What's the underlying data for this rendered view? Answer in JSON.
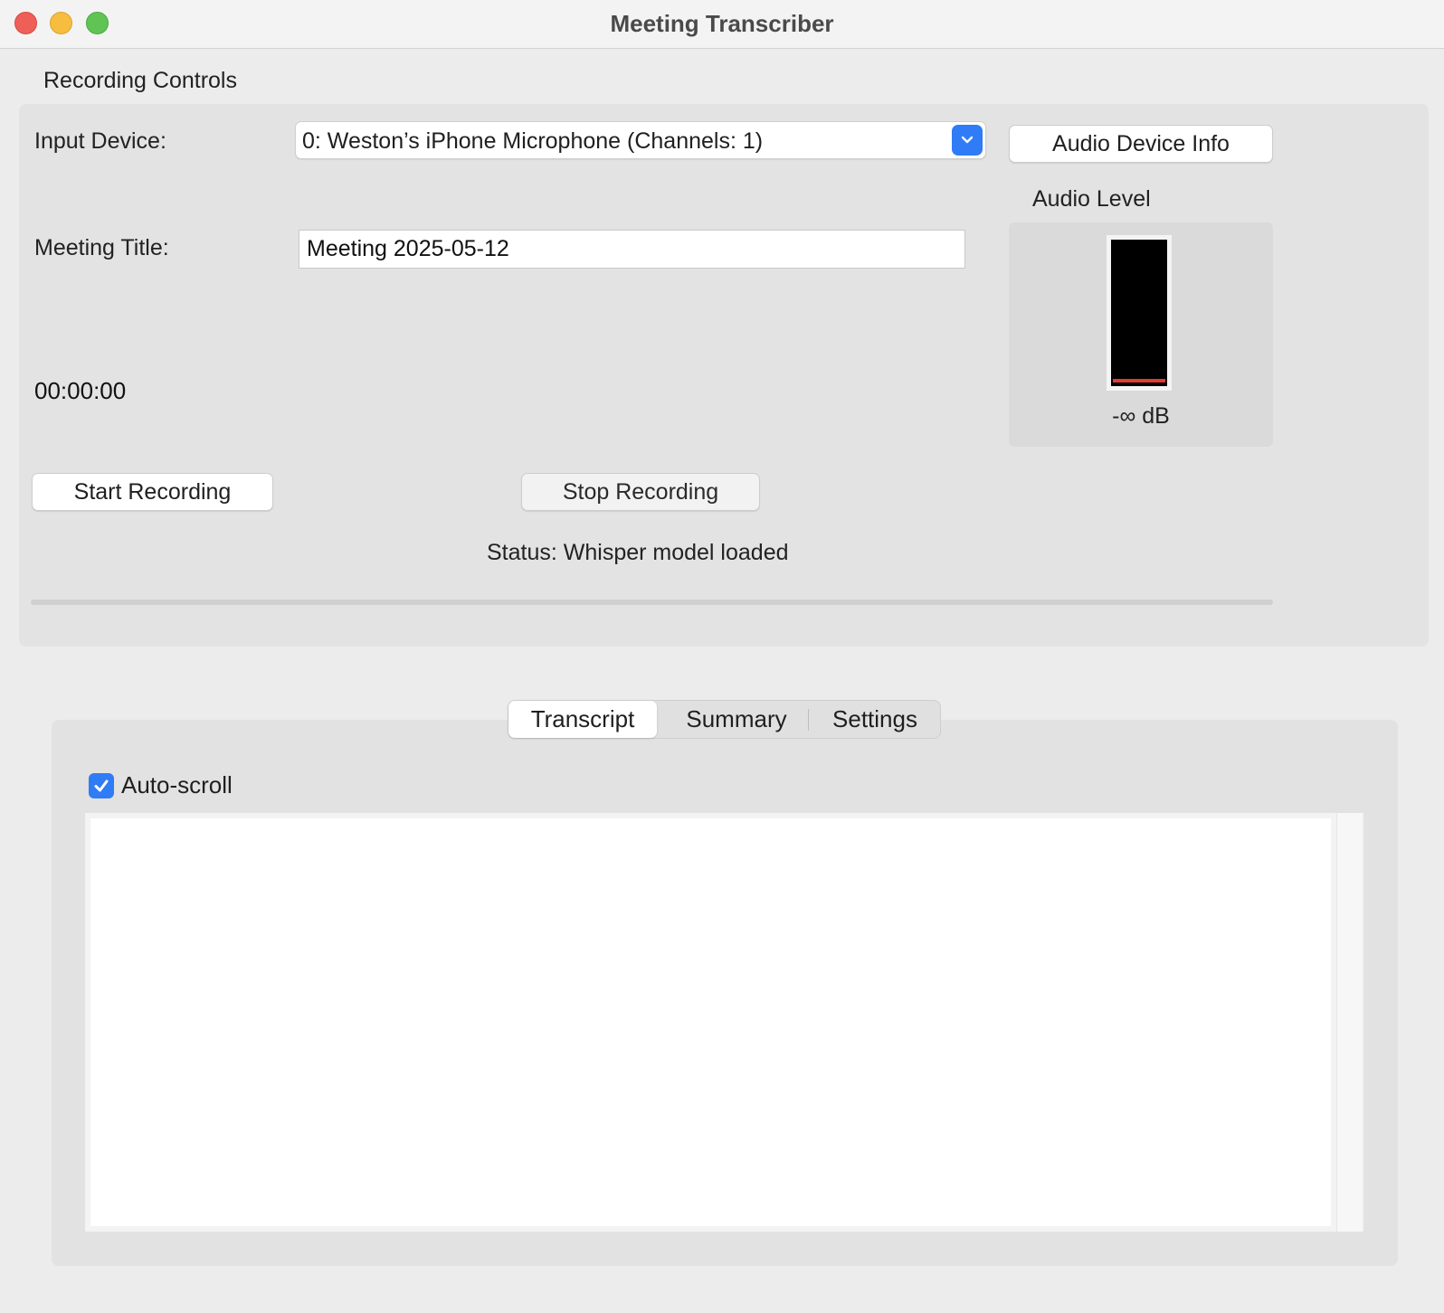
{
  "window": {
    "title": "Meeting Transcriber"
  },
  "recording": {
    "group_label": "Recording Controls",
    "input_device_label": "Input Device:",
    "input_device_value": "0: Weston’s iPhone Microphone (Channels: 1)",
    "audio_device_info_label": "Audio Device Info",
    "meeting_title_label": "Meeting Title:",
    "meeting_title_value": "Meeting 2025-05-12",
    "timer": "00:00:00",
    "start_label": "Start Recording",
    "stop_label": "Stop Recording",
    "status": "Status: Whisper model loaded",
    "audio_level_title": "Audio Level",
    "audio_level_db": "-∞ dB",
    "meter_fill_color": "#e03a32",
    "progress_value": 0
  },
  "tabs": {
    "items": [
      {
        "label": "Transcript",
        "selected": true
      },
      {
        "label": "Summary",
        "selected": false
      },
      {
        "label": "Settings",
        "selected": false
      }
    ]
  },
  "transcript": {
    "auto_scroll_label": "Auto-scroll",
    "auto_scroll_checked": true,
    "text": ""
  },
  "colors": {
    "accent": "#2f7cf6",
    "close": "#ee5f58",
    "minimize": "#f6bd3f",
    "maximize": "#5fc453"
  }
}
